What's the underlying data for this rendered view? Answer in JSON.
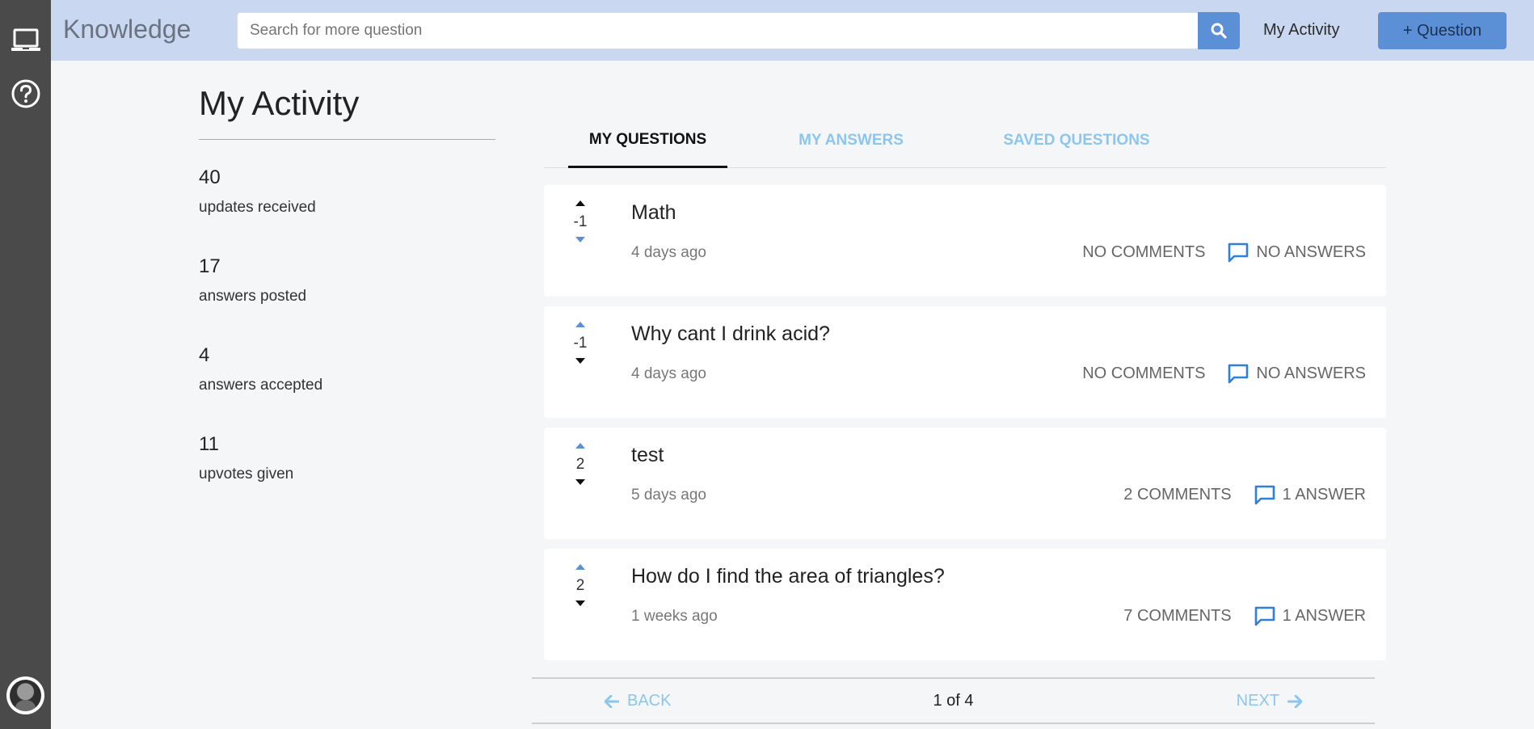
{
  "rail": {
    "icons": [
      "laptop-icon",
      "help-circle-icon",
      "user-avatar"
    ]
  },
  "header": {
    "brand": "Knowledge",
    "search_placeholder": "Search for more question",
    "search_value": "",
    "my_activity": "My Activity",
    "add_question": "+ Question"
  },
  "activity": {
    "title": "My Activity",
    "stats": [
      {
        "value": "40",
        "label": "updates received"
      },
      {
        "value": "17",
        "label": "answers posted"
      },
      {
        "value": "4",
        "label": "answers accepted"
      },
      {
        "value": "11",
        "label": "upvotes given"
      }
    ]
  },
  "tabs": [
    {
      "label": "MY QUESTIONS",
      "active": true
    },
    {
      "label": "MY ANSWERS",
      "active": false
    },
    {
      "label": "SAVED QUESTIONS",
      "active": false
    }
  ],
  "questions": [
    {
      "title": "Math",
      "score": "-1",
      "time": "4 days ago",
      "comments": "NO COMMENTS",
      "answers": "NO ANSWERS"
    },
    {
      "title": "Why cant I drink acid?",
      "score": "-1",
      "time": "4 days ago",
      "comments": "NO COMMENTS",
      "answers": "NO ANSWERS"
    },
    {
      "title": "test",
      "score": "2",
      "time": "5 days ago",
      "comments": "2 COMMENTS",
      "answers": "1 ANSWER"
    },
    {
      "title": "How do I find the area of triangles?",
      "score": "2",
      "time": "1 weeks ago",
      "comments": "7 COMMENTS",
      "answers": "1 ANSWER"
    }
  ],
  "pagination": {
    "back": "BACK",
    "page": "1 of 4",
    "next": "NEXT"
  },
  "colors": {
    "accent": "#5b8fd6",
    "header_bg": "#c9d8f0",
    "rail_bg": "#4a4a4a",
    "link_inactive": "#8cc6ee",
    "answer_icon": "#2f80d8"
  }
}
